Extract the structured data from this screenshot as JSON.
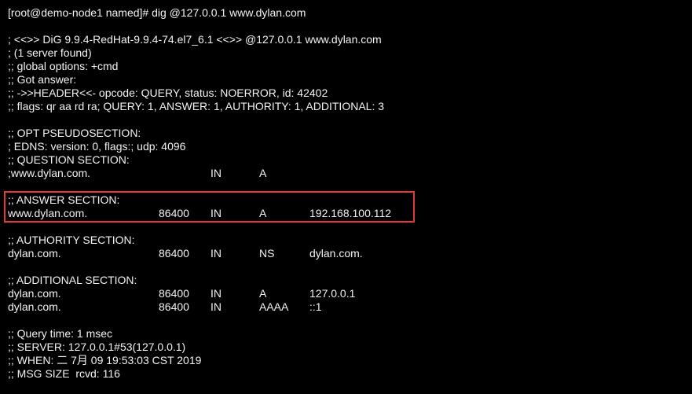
{
  "prompt": "[root@demo-node1 named]# dig @127.0.0.1 www.dylan.com",
  "header_lines": [
    "; <<>> DiG 9.9.4-RedHat-9.9.4-74.el7_6.1 <<>> @127.0.0.1 www.dylan.com",
    "; (1 server found)",
    ";; global options: +cmd",
    ";; Got answer:",
    ";; ->>HEADER<<- opcode: QUERY, status: NOERROR, id: 42402",
    ";; flags: qr aa rd ra; QUERY: 1, ANSWER: 1, AUTHORITY: 1, ADDITIONAL: 3"
  ],
  "opt_section": {
    "title": ";; OPT PSEUDOSECTION:",
    "edns": "; EDNS: version: 0, flags:; udp: 4096"
  },
  "question_section": {
    "title": ";; QUESTION SECTION:",
    "row": {
      "name": ";www.dylan.com.",
      "class": "IN",
      "type": "A"
    }
  },
  "answer_section": {
    "title": ";; ANSWER SECTION:",
    "row": {
      "name": "www.dylan.com.",
      "ttl": "86400",
      "class": "IN",
      "type": "A",
      "data": "192.168.100.112"
    }
  },
  "authority_section": {
    "title": ";; AUTHORITY SECTION:",
    "row": {
      "name": "dylan.com.",
      "ttl": "86400",
      "class": "IN",
      "type": "NS",
      "data": "dylan.com."
    }
  },
  "additional_section": {
    "title": ";; ADDITIONAL SECTION:",
    "rows": [
      {
        "name": "dylan.com.",
        "ttl": "86400",
        "class": "IN",
        "type": "A",
        "data": "127.0.0.1"
      },
      {
        "name": "dylan.com.",
        "ttl": "86400",
        "class": "IN",
        "type": "AAAA",
        "data": "::1"
      }
    ]
  },
  "footer_lines": [
    ";; Query time: 1 msec",
    ";; SERVER: 127.0.0.1#53(127.0.0.1)",
    ";; WHEN: 二 7月 09 19:53:03 CST 2019",
    ";; MSG SIZE  rcvd: 116"
  ],
  "colors": {
    "background": "#000000",
    "text": "#f2f2f2",
    "highlight_border": "#e53935"
  }
}
